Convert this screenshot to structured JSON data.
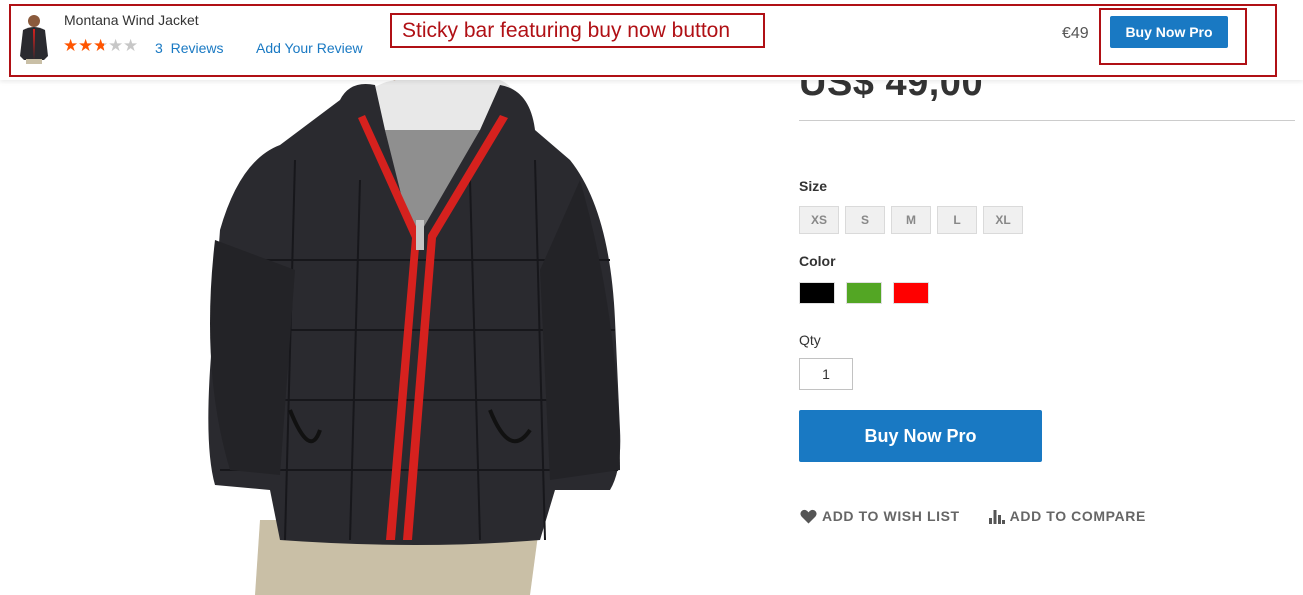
{
  "sticky_bar": {
    "product_name": "Montana Wind Jacket",
    "rating_fraction": 0.55,
    "reviews_count": "3",
    "reviews_label": "Reviews",
    "add_review_label": "Add Your Review",
    "callout_text": "Sticky bar featuring buy now button",
    "price": "€49",
    "buy_button_label": "Buy Now Pro"
  },
  "product": {
    "price": "US$ 49,00",
    "size_label": "Size",
    "sizes": [
      "XS",
      "S",
      "M",
      "L",
      "XL"
    ],
    "color_label": "Color",
    "colors": [
      "#000000",
      "#53a624",
      "#ff0000"
    ],
    "qty_label": "Qty",
    "qty_value": "1",
    "buy_button_label": "Buy Now Pro",
    "wishlist_label": "ADD TO WISH LIST",
    "compare_label": "ADD TO COMPARE"
  },
  "theme": {
    "accent": "#1979c3",
    "annotation": "#b01015",
    "star_filled": "#ff5501",
    "star_empty": "#c7c7c7"
  },
  "icons": [
    "heart-icon",
    "bar-chart-icon",
    "star-icon"
  ]
}
